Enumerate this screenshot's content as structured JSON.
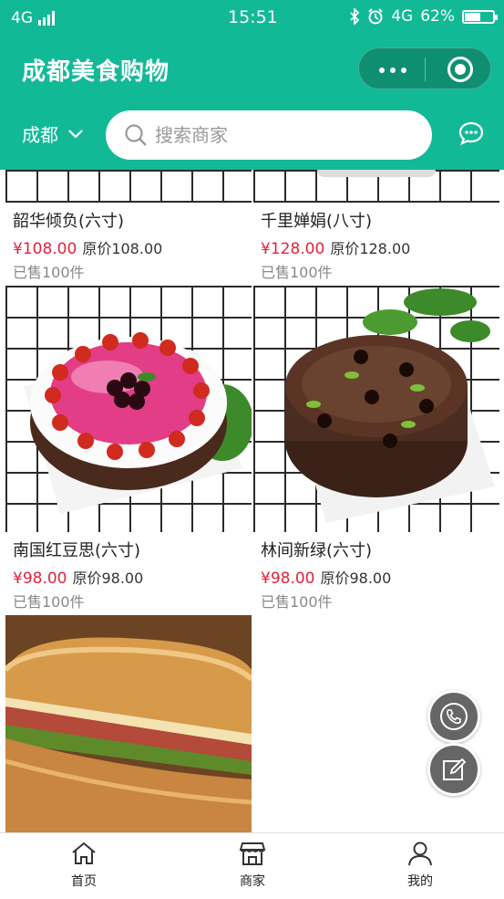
{
  "status_bar": {
    "network": "4G",
    "time": "15:51",
    "network_right": "4G",
    "battery_percent": "62%",
    "battery_level": 0.62
  },
  "nav": {
    "title": "成都美食购物"
  },
  "search": {
    "city": "成都",
    "placeholder": "搜索商家"
  },
  "products": [
    {
      "name": "韶华倾负(六寸)",
      "price": "¥108.00",
      "original_price": "原价108.00",
      "sold": "已售100件"
    },
    {
      "name": "千里婵娟(八寸)",
      "price": "¥128.00",
      "original_price": "原价128.00",
      "sold": "已售100件"
    },
    {
      "name": "南国红豆思(六寸)",
      "price": "¥98.00",
      "original_price": "原价98.00",
      "sold": "已售100件"
    },
    {
      "name": "林间新绿(六寸)",
      "price": "¥98.00",
      "original_price": "原价98.00",
      "sold": "已售100件"
    },
    {
      "name": "",
      "price": "",
      "original_price": "",
      "sold": ""
    }
  ],
  "tabs": [
    {
      "label": "首页",
      "icon": "home-icon"
    },
    {
      "label": "商家",
      "icon": "store-icon"
    },
    {
      "label": "我的",
      "icon": "user-icon"
    }
  ],
  "colors": {
    "brand": "#12b997",
    "price": "#e0233c"
  }
}
